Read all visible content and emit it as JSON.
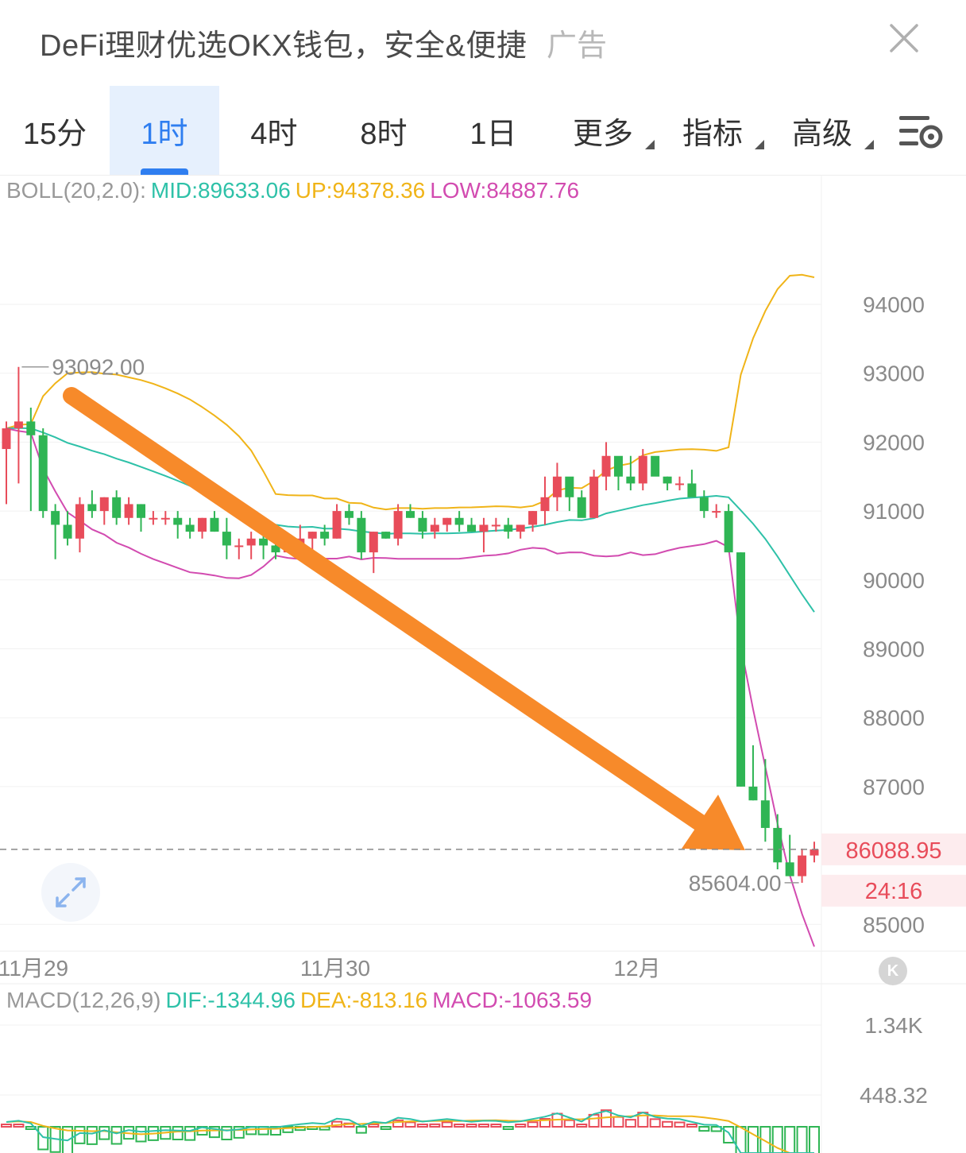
{
  "ad": {
    "text": "DeFi理财优选OKX钱包，安全&便捷",
    "tag": "广告"
  },
  "tabs": [
    {
      "label": "15分",
      "active": false,
      "dropdown": false
    },
    {
      "label": "1时",
      "active": true,
      "dropdown": false
    },
    {
      "label": "4时",
      "active": false,
      "dropdown": false
    },
    {
      "label": "8时",
      "active": false,
      "dropdown": false
    },
    {
      "label": "1日",
      "active": false,
      "dropdown": false
    },
    {
      "label": "更多",
      "active": false,
      "dropdown": true
    },
    {
      "label": "指标",
      "active": false,
      "dropdown": true
    },
    {
      "label": "高级",
      "active": false,
      "dropdown": true
    }
  ],
  "icons": {
    "close": "close-icon",
    "settings": "chart-settings-icon",
    "expand": "expand-icon",
    "kline": "kline-logo-icon"
  },
  "boll": {
    "prefix": "BOLL(20,2.0):",
    "mid": "MID:89633.06",
    "up": "UP:94378.36",
    "low": "LOW:84887.76"
  },
  "macd": {
    "prefix": "MACD(12,26,9)",
    "dif": "DIF:-1344.96",
    "dea": "DEA:-813.16",
    "macd": "MACD:-1063.59"
  },
  "kline_logo": "K",
  "price": {
    "current": "86088.95",
    "countdown": "24:16",
    "high_label": "93092.00",
    "low_label": "85604.00"
  },
  "colors": {
    "up": "#e84c5a",
    "down": "#2fb554",
    "mid": "#2ec1a8",
    "upper": "#f0b418",
    "lower": "#d24bb0",
    "accent": "#2f7ef0",
    "arrow": "#f78a2a"
  },
  "chart_data": {
    "type": "candlestick",
    "y_ticks": [
      "94000",
      "93000",
      "92000",
      "91000",
      "90000",
      "89000",
      "88000",
      "87000",
      "85000"
    ],
    "macd_y_ticks": [
      "1.34K",
      "448.32"
    ],
    "x_ticks": [
      "11月29",
      "11月30",
      "12月"
    ],
    "candles": [
      [
        91900,
        92300,
        91100,
        92200
      ],
      [
        92200,
        93092,
        91400,
        92300
      ],
      [
        92300,
        92500,
        91000,
        92100
      ],
      [
        92100,
        92200,
        90900,
        91000
      ],
      [
        91000,
        91100,
        90300,
        90800
      ],
      [
        90800,
        91000,
        90500,
        90600
      ],
      [
        90600,
        91200,
        90400,
        91100
      ],
      [
        91100,
        91300,
        90900,
        91000
      ],
      [
        91000,
        91200,
        90800,
        91200
      ],
      [
        91200,
        91300,
        90800,
        90900
      ],
      [
        90900,
        91200,
        90800,
        91100
      ],
      [
        91100,
        91100,
        90700,
        90900
      ],
      [
        90900,
        91000,
        90800,
        90900
      ],
      [
        90900,
        91000,
        90800,
        90900
      ],
      [
        90900,
        91000,
        90600,
        90800
      ],
      [
        90800,
        90900,
        90600,
        90700
      ],
      [
        90700,
        90900,
        90600,
        90900
      ],
      [
        90900,
        91000,
        90700,
        90700
      ],
      [
        90700,
        90900,
        90300,
        90500
      ],
      [
        90500,
        90600,
        90300,
        90500
      ],
      [
        90500,
        90700,
        90300,
        90600
      ],
      [
        90600,
        90700,
        90300,
        90500
      ],
      [
        90500,
        90700,
        90300,
        90400
      ],
      [
        90400,
        90600,
        90400,
        90500
      ],
      [
        90500,
        90800,
        90300,
        90600
      ],
      [
        90600,
        90700,
        90400,
        90700
      ],
      [
        90700,
        90800,
        90500,
        90600
      ],
      [
        90600,
        91100,
        90600,
        91000
      ],
      [
        91000,
        91100,
        90800,
        90900
      ],
      [
        90900,
        91000,
        90300,
        90400
      ],
      [
        90400,
        90700,
        90100,
        90700
      ],
      [
        90700,
        90700,
        90600,
        90600
      ],
      [
        90600,
        91100,
        90500,
        91000
      ],
      [
        91000,
        91100,
        90900,
        90900
      ],
      [
        90900,
        91000,
        90600,
        90700
      ],
      [
        90700,
        90900,
        90600,
        90800
      ],
      [
        90800,
        90900,
        90700,
        90900
      ],
      [
        90900,
        91000,
        90700,
        90800
      ],
      [
        90800,
        90900,
        90700,
        90700
      ],
      [
        90700,
        90900,
        90400,
        90800
      ],
      [
        90800,
        90900,
        90700,
        90800
      ],
      [
        90800,
        90900,
        90600,
        90700
      ],
      [
        90700,
        90800,
        90600,
        90800
      ],
      [
        90800,
        91000,
        90700,
        91000
      ],
      [
        91000,
        91500,
        90800,
        91200
      ],
      [
        91200,
        91700,
        91000,
        91500
      ],
      [
        91500,
        91400,
        91000,
        91200
      ],
      [
        91200,
        91300,
        91000,
        90900
      ],
      [
        90900,
        91600,
        90900,
        91500
      ],
      [
        91500,
        92000,
        91300,
        91800
      ],
      [
        91800,
        91600,
        91300,
        91500
      ],
      [
        91500,
        91800,
        91300,
        91400
      ],
      [
        91400,
        91900,
        91300,
        91800
      ],
      [
        91800,
        91700,
        91600,
        91500
      ],
      [
        91500,
        91500,
        91300,
        91400
      ],
      [
        91400,
        91500,
        91300,
        91400
      ],
      [
        91400,
        91600,
        91300,
        91200
      ],
      [
        91200,
        91300,
        90900,
        91000
      ],
      [
        91000,
        91100,
        90900,
        91000
      ],
      [
        91000,
        91100,
        90400,
        90400
      ],
      [
        90400,
        90400,
        87000,
        87000
      ],
      [
        87000,
        87600,
        86800,
        86800
      ],
      [
        86800,
        87400,
        86200,
        86400
      ],
      [
        86400,
        86600,
        85800,
        85900
      ],
      [
        85900,
        86300,
        85700,
        85700
      ],
      [
        85700,
        86100,
        85604,
        86000
      ],
      [
        86000,
        86200,
        85900,
        86089
      ]
    ]
  }
}
